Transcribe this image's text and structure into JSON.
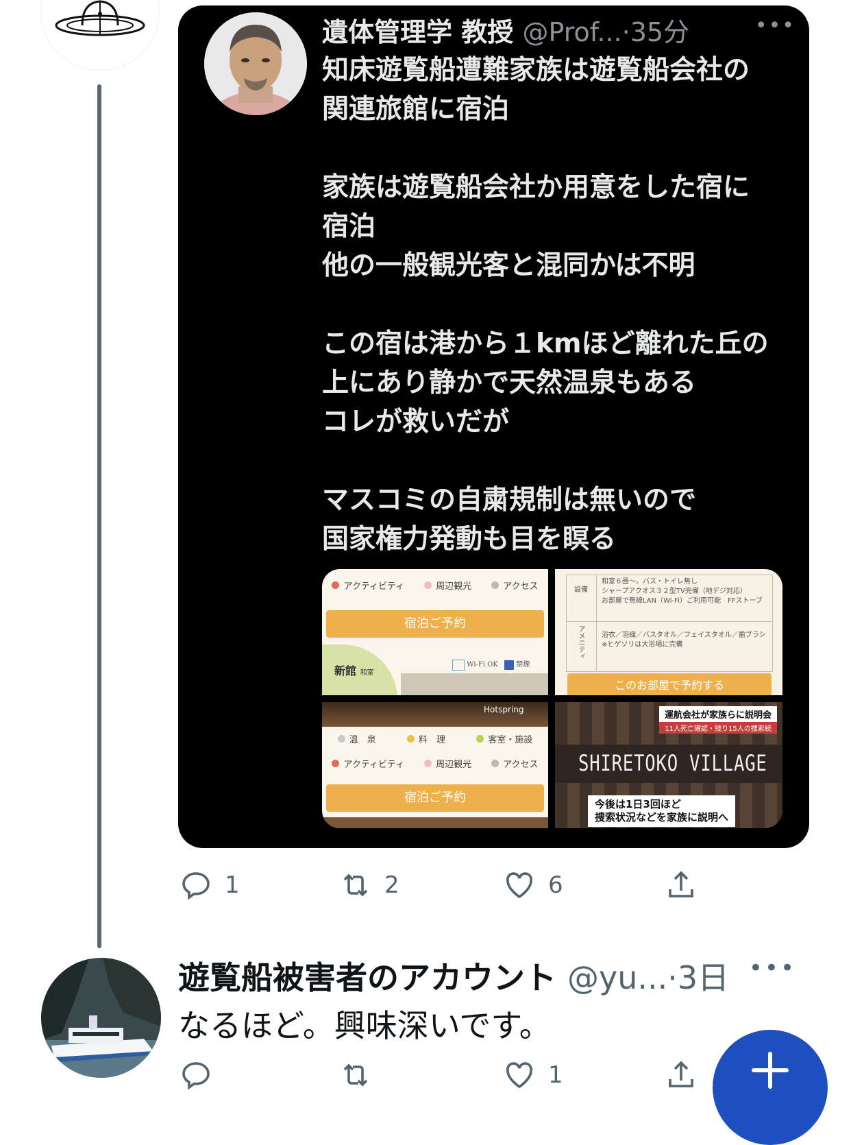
{
  "thread": {
    "quoted": {
      "name": "遺体管理学 教授",
      "handle": "@Prof...",
      "time": "35分",
      "text": "知床遊覧船遭難家族は遊覧船会社の\n関連旅館に宿泊\n\n家族は遊覧船会社か用意をした宿に\n宿泊\n他の一般観光客と混同かは不明\n\nこの宿は港から１kmほど離れた丘の\n上にあり静かで天然温泉もある\nコレが救いだが\n\nマスコミの自粛規制は無いので\n国家権力発動も目を瞑る",
      "images": {
        "img1": {
          "tags": [
            "アクティビティ",
            "周辺観光",
            "アクセス"
          ],
          "button": "宿泊ご予約",
          "building": "新館",
          "room": "和室",
          "wifi": "Wi-Fi OK",
          "nosmoke": "禁煙"
        },
        "img2": {
          "label_a": "設備",
          "text_a": "和室６畳〜。バス・トイレ無し\nシャープアクオス３２型TV完備（地デジ対応）\nお部屋で無線LAN（Wi-Fi）ご利用可能　FFストーブ",
          "label_b": "アメニティ",
          "text_b": "浴衣／羽織／バスタオル／フェイスタオル／歯ブラシ　※ヒゲソリは大浴場に完備",
          "button": "このお部屋で予約する"
        },
        "img3": {
          "hotspring": "Hotspring",
          "tags_row1": [
            "温　泉",
            "料　理",
            "客室・施設"
          ],
          "tags_row2": [
            "アクティビティ",
            "周辺観光",
            "アクセス"
          ],
          "button": "宿泊ご予約"
        },
        "img4": {
          "caption_top": "運航会社が家族らに説明会",
          "caption_sub": "11人死亡確認・残り15人の捜索続",
          "sign": "SHIRETOKO VILLAGE",
          "caption_bottom_1": "今後は1日3回ほど",
          "caption_bottom_2": "捜索状況などを家族に説明へ"
        }
      }
    },
    "actions": {
      "reply": "1",
      "retweet": "2",
      "like": "6",
      "share": ""
    }
  },
  "reply": {
    "name": "遊覧船被害者のアカウント",
    "handle": "@yu...",
    "time": "3日",
    "text": "なるほど。興味深いです。",
    "actions": {
      "reply": "",
      "retweet": "",
      "like": "1",
      "share": ""
    }
  },
  "fab": {
    "icon": "plus-icon"
  },
  "colors": {
    "card_bg": "#000000",
    "accent": "#1d4fbf",
    "muted": "#536471",
    "orange": "#eeb04a"
  }
}
